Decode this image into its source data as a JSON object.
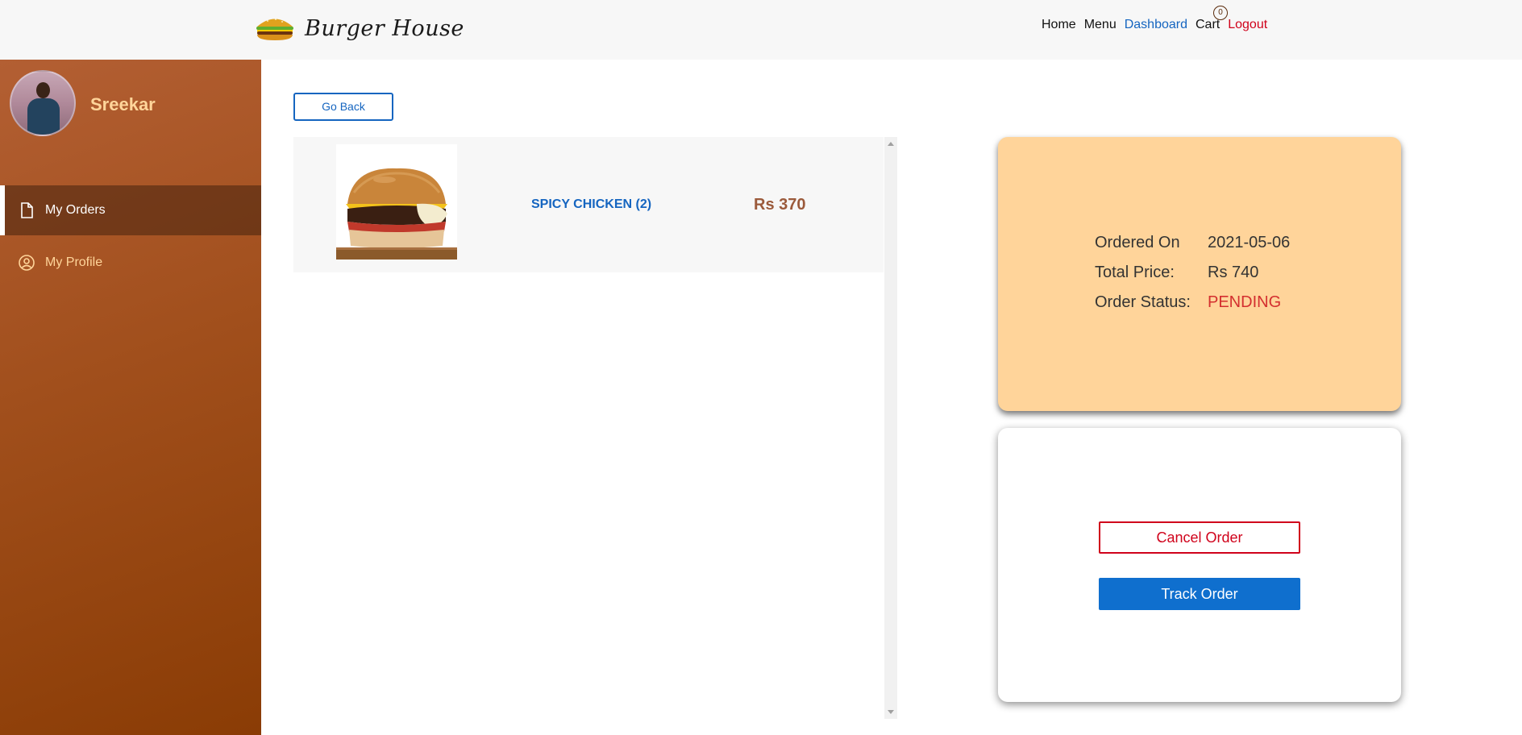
{
  "brand": {
    "title": "Burger House",
    "logo_icon": "burger-icon"
  },
  "nav": {
    "home": "Home",
    "menu": "Menu",
    "dashboard": "Dashboard",
    "cart": "Cart",
    "cart_count": "0",
    "logout": "Logout",
    "active": "Dashboard"
  },
  "sidebar": {
    "user_name": "Sreekar",
    "items": [
      {
        "label": "My Orders",
        "icon": "document-icon",
        "active": true
      },
      {
        "label": "My Profile",
        "icon": "user-circle-icon",
        "active": false
      }
    ]
  },
  "main": {
    "go_back_label": "Go Back",
    "order_items": [
      {
        "name": "SPICY CHICKEN (2)",
        "price": "Rs 370"
      }
    ]
  },
  "summary": {
    "ordered_on_label": "Ordered On",
    "ordered_on_value": "2021-05-06",
    "total_price_label": "Total Price:",
    "total_price_value": "Rs 740",
    "status_label": "Order Status:",
    "status_value": "PENDING"
  },
  "actions": {
    "cancel_label": "Cancel Order",
    "track_label": "Track Order"
  },
  "colors": {
    "accent_blue": "#1565c0",
    "danger_red": "#d0021b",
    "sidebar_brown": "#a14f1c",
    "summary_bg": "#ffd49a"
  }
}
